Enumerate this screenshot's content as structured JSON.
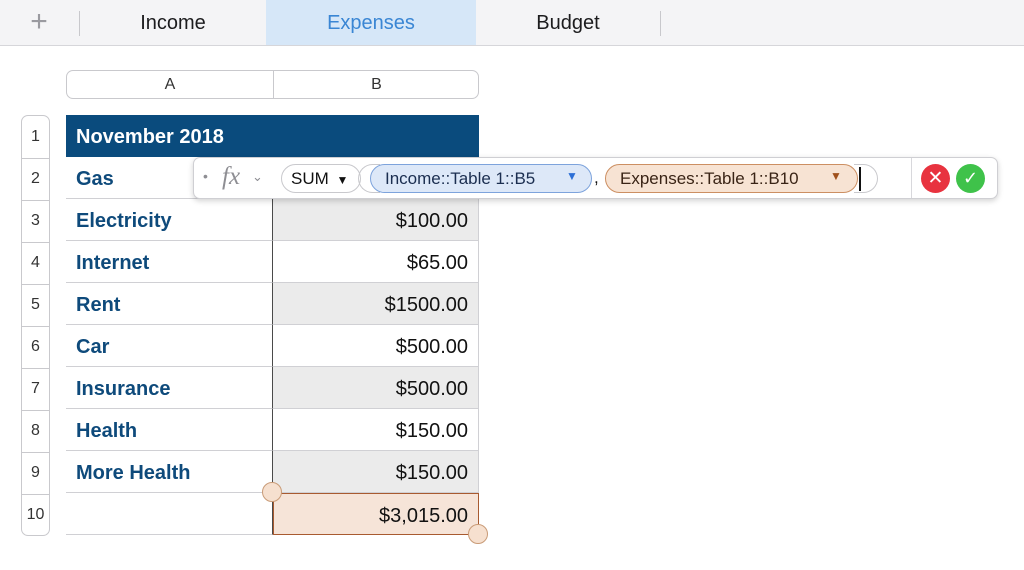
{
  "tabs": {
    "add_icon": "plus-icon",
    "items": [
      {
        "label": "Income",
        "active": false
      },
      {
        "label": "Expenses",
        "active": true
      },
      {
        "label": "Budget",
        "active": false
      }
    ]
  },
  "sheet": {
    "columns": [
      "A",
      "B"
    ],
    "rows": [
      "1",
      "2",
      "3",
      "4",
      "5",
      "6",
      "7",
      "8",
      "9",
      "10"
    ],
    "header": {
      "a": "November 2018",
      "b": ""
    },
    "body": [
      {
        "a": "Gas",
        "b": ""
      },
      {
        "a": "Electricity",
        "b": "$100.00"
      },
      {
        "a": "Internet",
        "b": "$65.00"
      },
      {
        "a": "Rent",
        "b": "$1500.00"
      },
      {
        "a": "Car",
        "b": "$500.00"
      },
      {
        "a": "Insurance",
        "b": "$500.00"
      },
      {
        "a": "Health",
        "b": "$150.00"
      },
      {
        "a": "More Health",
        "b": "$150.00"
      },
      {
        "a": "",
        "b": "$3,015.00"
      }
    ]
  },
  "formula_bar": {
    "bullet": "•",
    "fx_label": "fx",
    "fx_chevron": "⌄",
    "function_name": "SUM",
    "function_arrow": "▼",
    "ref1": "Income::Table 1::B5",
    "ref1_arrow": "▼",
    "separator": ",",
    "ref2": "Expenses::Table 1::B10",
    "ref2_arrow": "▼",
    "cancel_symbol": "✕",
    "accept_symbol": "✓"
  },
  "colors": {
    "accent": "#3a86d4",
    "header_fill": "#0a4b7d",
    "label_text": "#0e4a7b",
    "ref1_fill": "#dde8f8",
    "ref2_fill": "#f7e3d3",
    "cancel": "#e8333f",
    "accept": "#3fc24a"
  }
}
